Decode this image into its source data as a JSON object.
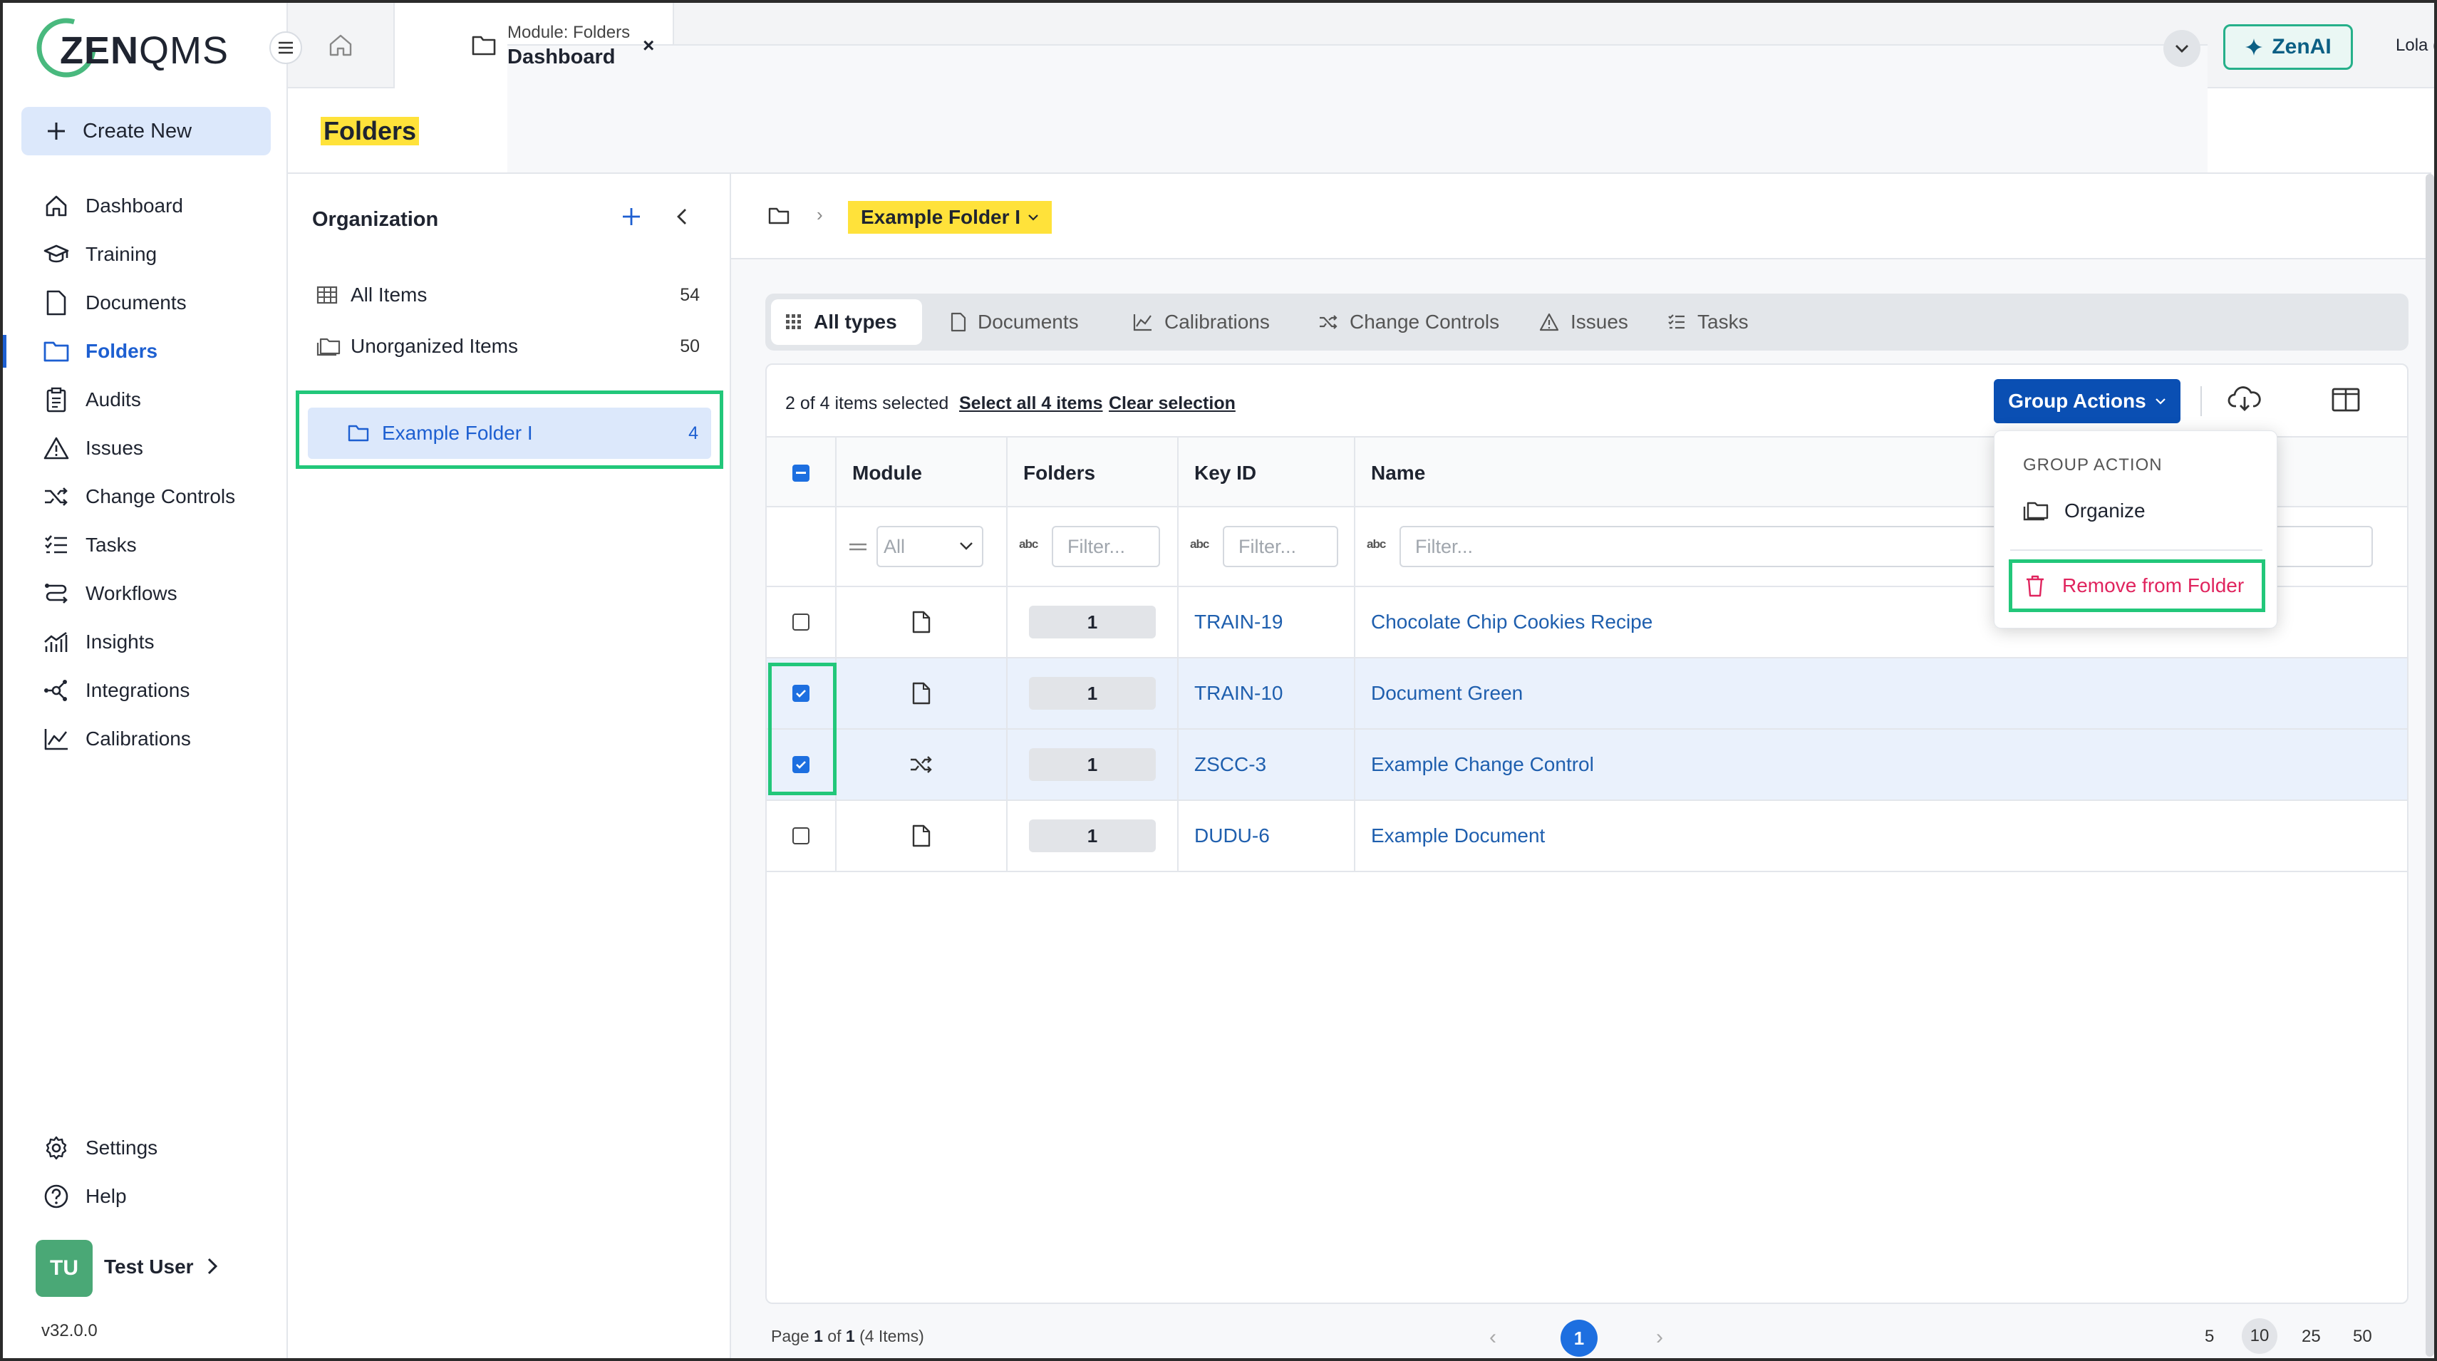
{
  "app": {
    "logo": "ZENQMS",
    "tab_module": "Module: Folders",
    "tab_title": "Dashboard",
    "tab_close": "×",
    "zenai_label": "ZenAI",
    "account": "Lola (THIS IS A ZENQMS TEST ACCOUNT)"
  },
  "sidebar": {
    "create_label": "Create New",
    "items": [
      {
        "label": "Dashboard",
        "icon": "home-icon"
      },
      {
        "label": "Training",
        "icon": "graduation-cap-icon"
      },
      {
        "label": "Documents",
        "icon": "document-icon"
      },
      {
        "label": "Folders",
        "icon": "folder-icon",
        "active": true
      },
      {
        "label": "Audits",
        "icon": "clipboard-icon"
      },
      {
        "label": "Issues",
        "icon": "warning-icon"
      },
      {
        "label": "Change Controls",
        "icon": "shuffle-icon"
      },
      {
        "label": "Tasks",
        "icon": "checklist-icon"
      },
      {
        "label": "Workflows",
        "icon": "workflow-icon"
      },
      {
        "label": "Insights",
        "icon": "insights-icon"
      },
      {
        "label": "Integrations",
        "icon": "integrations-icon"
      },
      {
        "label": "Calibrations",
        "icon": "chart-icon"
      }
    ],
    "settings_label": "Settings",
    "help_label": "Help",
    "user_initials": "TU",
    "user_name": "Test User",
    "version": "v32.0.0"
  },
  "page": {
    "title": "Folders"
  },
  "org": {
    "title": "Organization",
    "all_items_label": "All Items",
    "all_items_count": "54",
    "unorganized_label": "Unorganized Items",
    "unorganized_count": "50",
    "folder_label": "Example Folder I",
    "folder_count": "4"
  },
  "breadcrumb": {
    "current": "Example Folder I"
  },
  "types": {
    "tabs": [
      {
        "label": "All types",
        "active": true
      },
      {
        "label": "Documents"
      },
      {
        "label": "Calibrations"
      },
      {
        "label": "Change Controls"
      },
      {
        "label": "Issues"
      },
      {
        "label": "Tasks"
      }
    ]
  },
  "selection": {
    "info": "2 of 4 items selected",
    "select_all": "Select all 4 items",
    "clear": "Clear selection"
  },
  "group_actions": {
    "button_label": "Group Actions",
    "header": "GROUP ACTION",
    "organize": "Organize",
    "remove": "Remove from Folder"
  },
  "table": {
    "columns": [
      "Module",
      "Folders",
      "Key ID",
      "Name"
    ],
    "module_filter": "All",
    "filter_placeholder": "Filter...",
    "abc": "abc",
    "rows": [
      {
        "module": "document",
        "folders": "1",
        "key_id": "TRAIN-19",
        "name": "Chocolate Chip Cookies Recipe",
        "checked": false
      },
      {
        "module": "document",
        "folders": "1",
        "key_id": "TRAIN-10",
        "name": "Document Green",
        "checked": true
      },
      {
        "module": "change-control",
        "folders": "1",
        "key_id": "ZSCC-3",
        "name": "Example Change Control",
        "checked": true
      },
      {
        "module": "document",
        "folders": "1",
        "key_id": "DUDU-6",
        "name": "Example Document",
        "checked": false
      }
    ]
  },
  "pager": {
    "page_word": "Page",
    "page": "1",
    "of_word": "of",
    "total_pages": "1",
    "items": "(4 Items)",
    "current": "1",
    "sizes": [
      "5",
      "10",
      "25",
      "50"
    ],
    "active_size": "10"
  },
  "colors": {
    "primary": "#0a4fb3",
    "highlight": "#ffe23a",
    "accent_green": "#22c77a",
    "danger": "#e0245e"
  }
}
